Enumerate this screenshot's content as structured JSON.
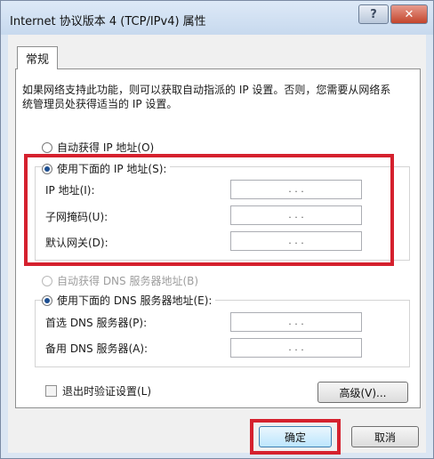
{
  "window": {
    "title": "Internet 协议版本 4 (TCP/IPv4) 属性",
    "help_glyph": "?",
    "close_glyph": "✕"
  },
  "tab": {
    "label": "常规"
  },
  "description": "如果网络支持此功能，则可以获取自动指派的 IP 设置。否则，您需要从网络系统管理员处获得适当的 IP 设置。",
  "ip_section": {
    "auto_label": "自动获得 IP 地址(O)",
    "manual_label": "使用下面的 IP 地址(S):",
    "fields": [
      {
        "label": "IP 地址(I):",
        "value": ". . ."
      },
      {
        "label": "子网掩码(U):",
        "value": ". . ."
      },
      {
        "label": "默认网关(D):",
        "value": ". . ."
      }
    ]
  },
  "dns_section": {
    "auto_label": "自动获得 DNS 服务器地址(B)",
    "manual_label": "使用下面的 DNS 服务器地址(E):",
    "fields": [
      {
        "label": "首选 DNS 服务器(P):",
        "value": ". . ."
      },
      {
        "label": "备用 DNS 服务器(A):",
        "value": ". . ."
      }
    ]
  },
  "validate_on_exit": {
    "label": "退出时验证设置(L)",
    "checked": false
  },
  "advanced_label": "高级(V)...",
  "ok_label": "确定",
  "cancel_label": "取消",
  "colors": {
    "highlight": "#d5212e",
    "accent": "#1d4f91"
  }
}
